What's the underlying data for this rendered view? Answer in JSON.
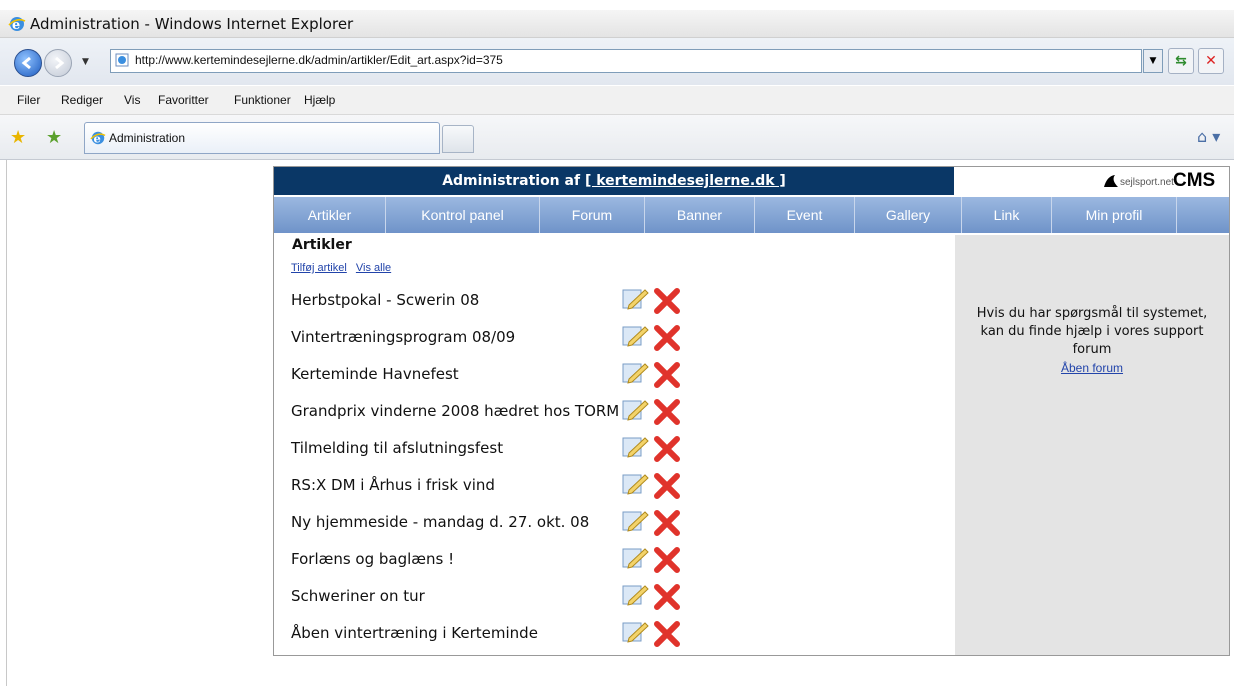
{
  "window": {
    "title": "Administration - Windows Internet Explorer"
  },
  "address": {
    "url": "http://www.kertemindesejlerne.dk/admin/artikler/Edit_art.aspx?id=375"
  },
  "menu": {
    "items": [
      "Filer",
      "Rediger",
      "Vis",
      "Favoritter",
      "Funktioner",
      "Hjælp"
    ]
  },
  "tab": {
    "label": "Administration"
  },
  "cms": {
    "header_prefix": "Administration af ",
    "header_link": "[ kertemindesejlerne.dk ]",
    "brand_small": "sejlsport.net",
    "brand_big": "CMS",
    "nav": [
      "Artikler",
      "Kontrol panel",
      "Forum",
      "Banner",
      "Event",
      "Gallery",
      "Link",
      "Min profil"
    ],
    "section_title": "Artikler",
    "link_add": "Tilføj artikel",
    "link_all": "Vis alle",
    "articles": [
      "Herbstpokal - Scwerin 08",
      "Vintertræningsprogram 08/09",
      "Kerteminde Havnefest",
      "Grandprix vinderne 2008 hædret hos TORM",
      "Tilmelding til afslutningsfest",
      "RS:X DM i Århus i frisk vind",
      "Ny hjemmeside - mandag d. 27. okt. 08",
      "Forlæns og baglæns !",
      "Schweriner on tur",
      "Åben vintertræning i Kerteminde"
    ],
    "help_line1": "Hvis du har spørgsmål til systemet,",
    "help_line2": "kan du finde hjælp i vores support",
    "help_line3": "forum",
    "help_link": "Åben forum"
  },
  "colors": {
    "header_bg": "#0a3766",
    "nav_bg": "#7fa0d2",
    "sidebar_bg": "#e4e4e4",
    "link": "#2244aa"
  }
}
